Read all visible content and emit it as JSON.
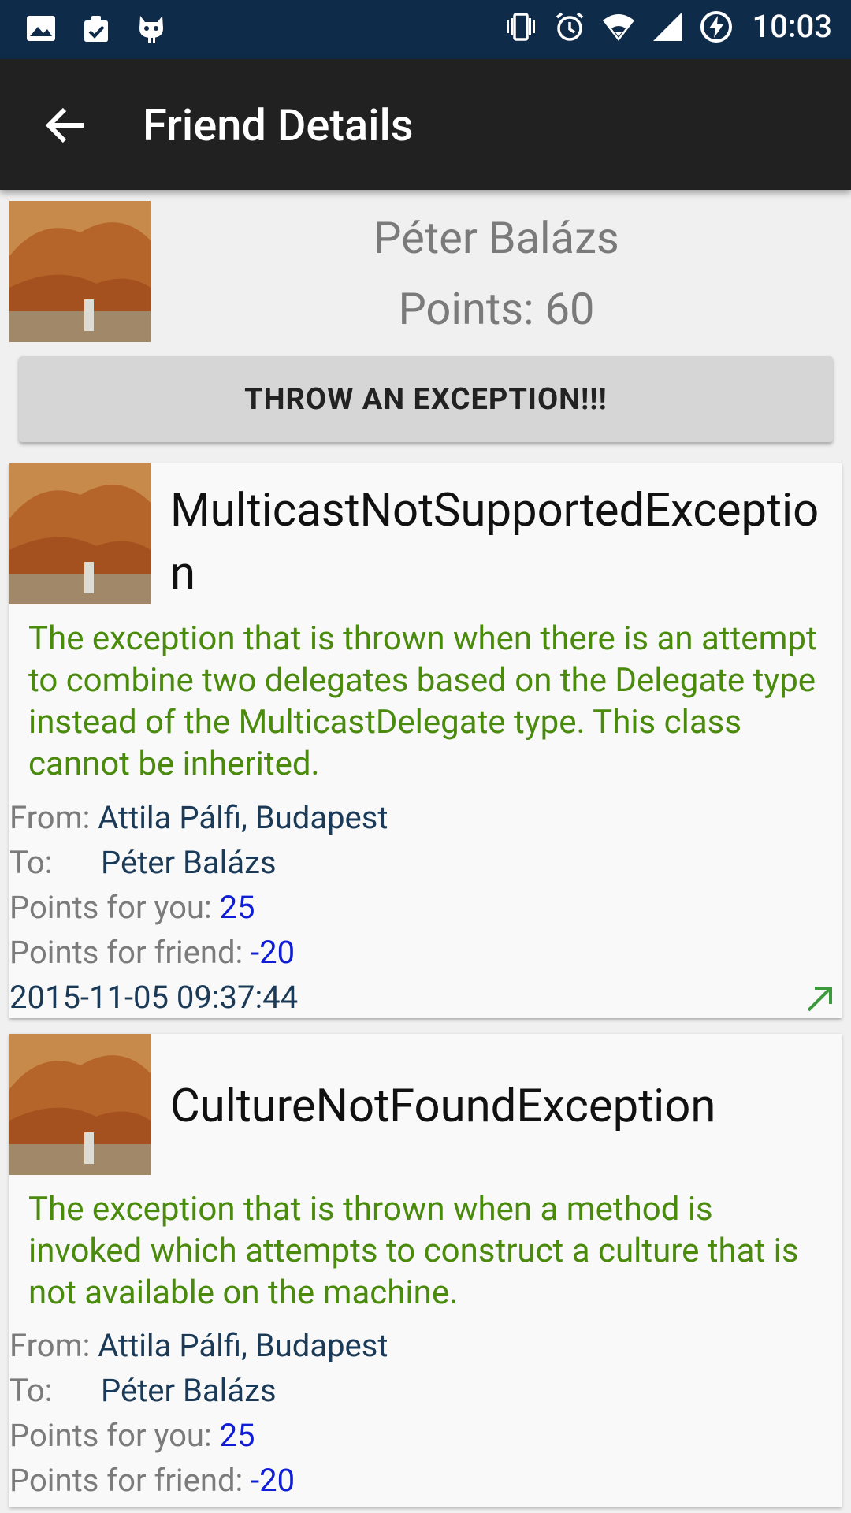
{
  "status_bar": {
    "time": "10:03",
    "left_icons": [
      "image-icon",
      "clipboard-check-icon",
      "cyanogen-mascot-icon"
    ],
    "right_icons": [
      "vibrate-icon",
      "alarm-icon",
      "wifi-icon",
      "signal-icon",
      "battery-charging-icon"
    ]
  },
  "toolbar": {
    "title": "Friend Details"
  },
  "friend": {
    "name": "Péter Balázs",
    "points": "Points: 60"
  },
  "throw_button": {
    "label": "THROW AN EXCEPTION!!!"
  },
  "cards": [
    {
      "title": "MulticastNotSupportedException",
      "description": "The exception that is thrown when there is an attempt to combine two delegates based on the Delegate type instead of the MulticastDelegate type. This class cannot be inherited.",
      "from_label": "From:",
      "from_value": "Attila Pálfi, Budapest",
      "to_label": "To:",
      "to_value": "Péter Balázs",
      "points_you_label": "Points for you:",
      "points_you_value": "25",
      "points_friend_label": "Points for friend:",
      "points_friend_value": "-20",
      "date": "2015-11-05 09:37:44"
    },
    {
      "title": "CultureNotFoundException",
      "description": "The exception that is thrown when a method is invoked which attempts to construct a culture that is not available on the machine.",
      "from_label": "From:",
      "from_value": "Attila Pálfi, Budapest",
      "to_label": "To:",
      "to_value": "Péter Balázs",
      "points_you_label": "Points for you:",
      "points_you_value": "25",
      "points_friend_label": "Points for friend:",
      "points_friend_value": "-20"
    }
  ],
  "colors": {
    "status_bar": "#0f2b4a",
    "toolbar": "#212121",
    "description_green": "#4a8a0c",
    "points_blue": "#0f1ed6",
    "link_arrow": "#3c9a3c"
  }
}
